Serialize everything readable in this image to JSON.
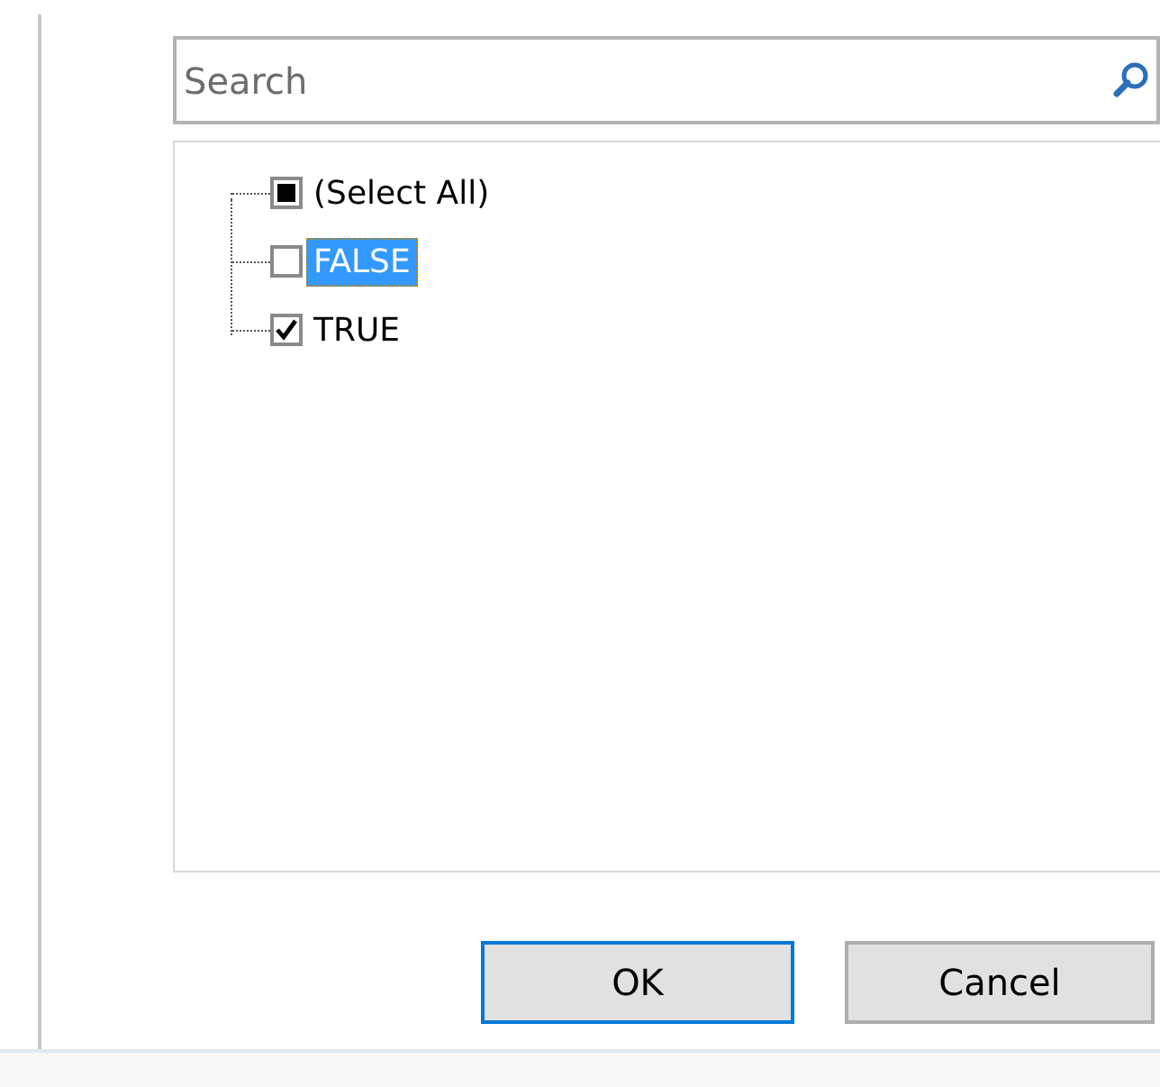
{
  "search": {
    "placeholder": "Search"
  },
  "items": [
    {
      "label": "(Select All)",
      "checked": false,
      "partial": true,
      "selected": false
    },
    {
      "label": "FALSE",
      "checked": false,
      "partial": false,
      "selected": true
    },
    {
      "label": "TRUE",
      "checked": true,
      "partial": false,
      "selected": false
    }
  ],
  "buttons": [
    {
      "label": "OK",
      "default": true
    },
    {
      "label": "Cancel",
      "default": false
    }
  ]
}
